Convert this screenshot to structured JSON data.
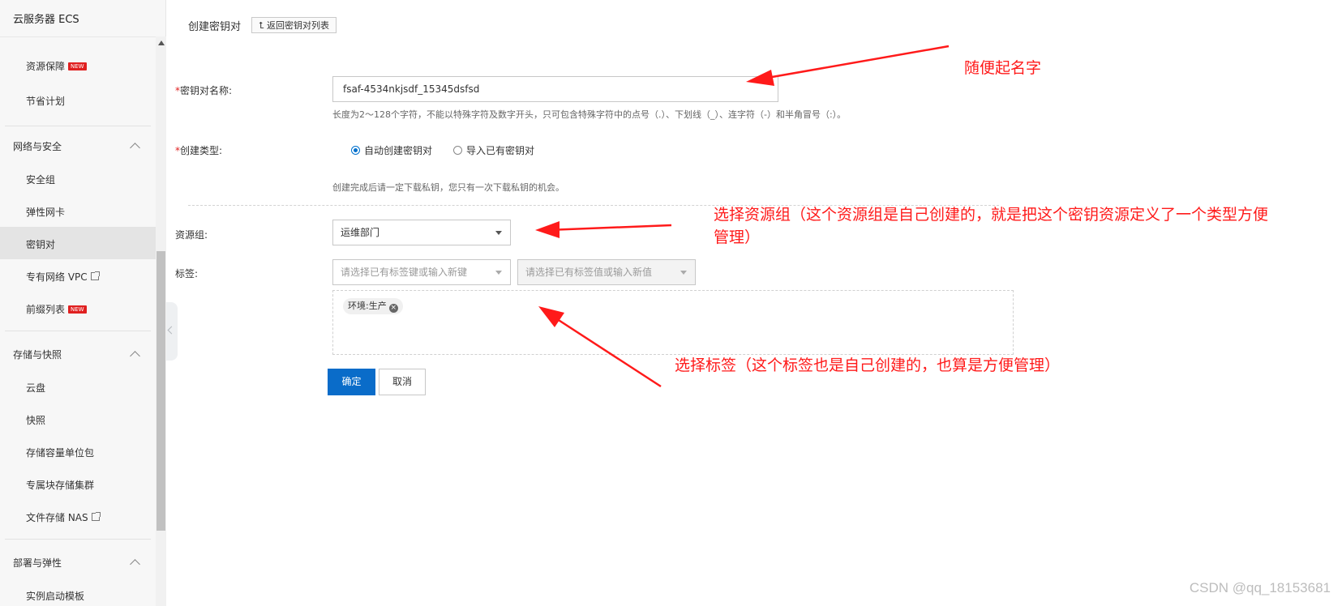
{
  "sidebar": {
    "title": "云服务器 ECS",
    "items_top": [
      {
        "label": "资源保障",
        "badge": "NEW"
      },
      {
        "label": "节省计划"
      }
    ],
    "group_network": "网络与安全",
    "network_items": [
      {
        "label": "安全组"
      },
      {
        "label": "弹性网卡"
      },
      {
        "label": "密钥对"
      },
      {
        "label": "专有网络 VPC"
      },
      {
        "label": "前缀列表",
        "badge": "NEW"
      }
    ],
    "group_storage": "存储与快照",
    "storage_items": [
      {
        "label": "云盘"
      },
      {
        "label": "快照"
      },
      {
        "label": "存储容量单位包"
      },
      {
        "label": "专属块存储集群"
      },
      {
        "label": "文件存储 NAS"
      }
    ],
    "group_deploy": "部署与弹性",
    "deploy_items": [
      {
        "label": "实例启动模板"
      }
    ],
    "active_item": "密钥对"
  },
  "header": {
    "title": "创建密钥对",
    "back_label": "返回密钥对列表"
  },
  "form": {
    "name": {
      "required_mark": "*",
      "label": "密钥对名称:",
      "value": "fsaf-4534nkjsdf_15345dsfsd",
      "hint": "长度为2～128个字符，不能以特殊字符及数字开头，只可包含特殊字符中的点号（.）、下划线（_）、连字符（-）和半角冒号（:）。"
    },
    "type": {
      "required_mark": "*",
      "label": "创建类型:",
      "options": [
        "自动创建密钥对",
        "导入已有密钥对"
      ],
      "selected": "自动创建密钥对",
      "hint": "创建完成后请一定下载私钥，您只有一次下载私钥的机会。"
    },
    "resource_group": {
      "label": "资源组:",
      "value": "运维部门"
    },
    "tags": {
      "label": "标签:",
      "key_placeholder": "请选择已有标签键或输入新键",
      "value_placeholder": "请选择已有标签值或输入新值",
      "selected_tags": [
        "环境:生产"
      ]
    },
    "confirm_label": "确定",
    "cancel_label": "取消"
  },
  "annotations": {
    "note_name": "随便起名字",
    "note_group_line1": "选择资源组（这个资源组是自己创建的，就是把这个密钥资源定义了一个类型方便",
    "note_group_line2": "管理）",
    "note_tags": "选择标签（这个标签也是自己创建的，也算是方便管理）",
    "arrow_color": "#ff1a1a"
  },
  "watermark": "CSDN @qq_18153681",
  "colors": {
    "primary": "#0a6cc9",
    "required": "#e02020",
    "annotation": "#ff1a1a"
  }
}
